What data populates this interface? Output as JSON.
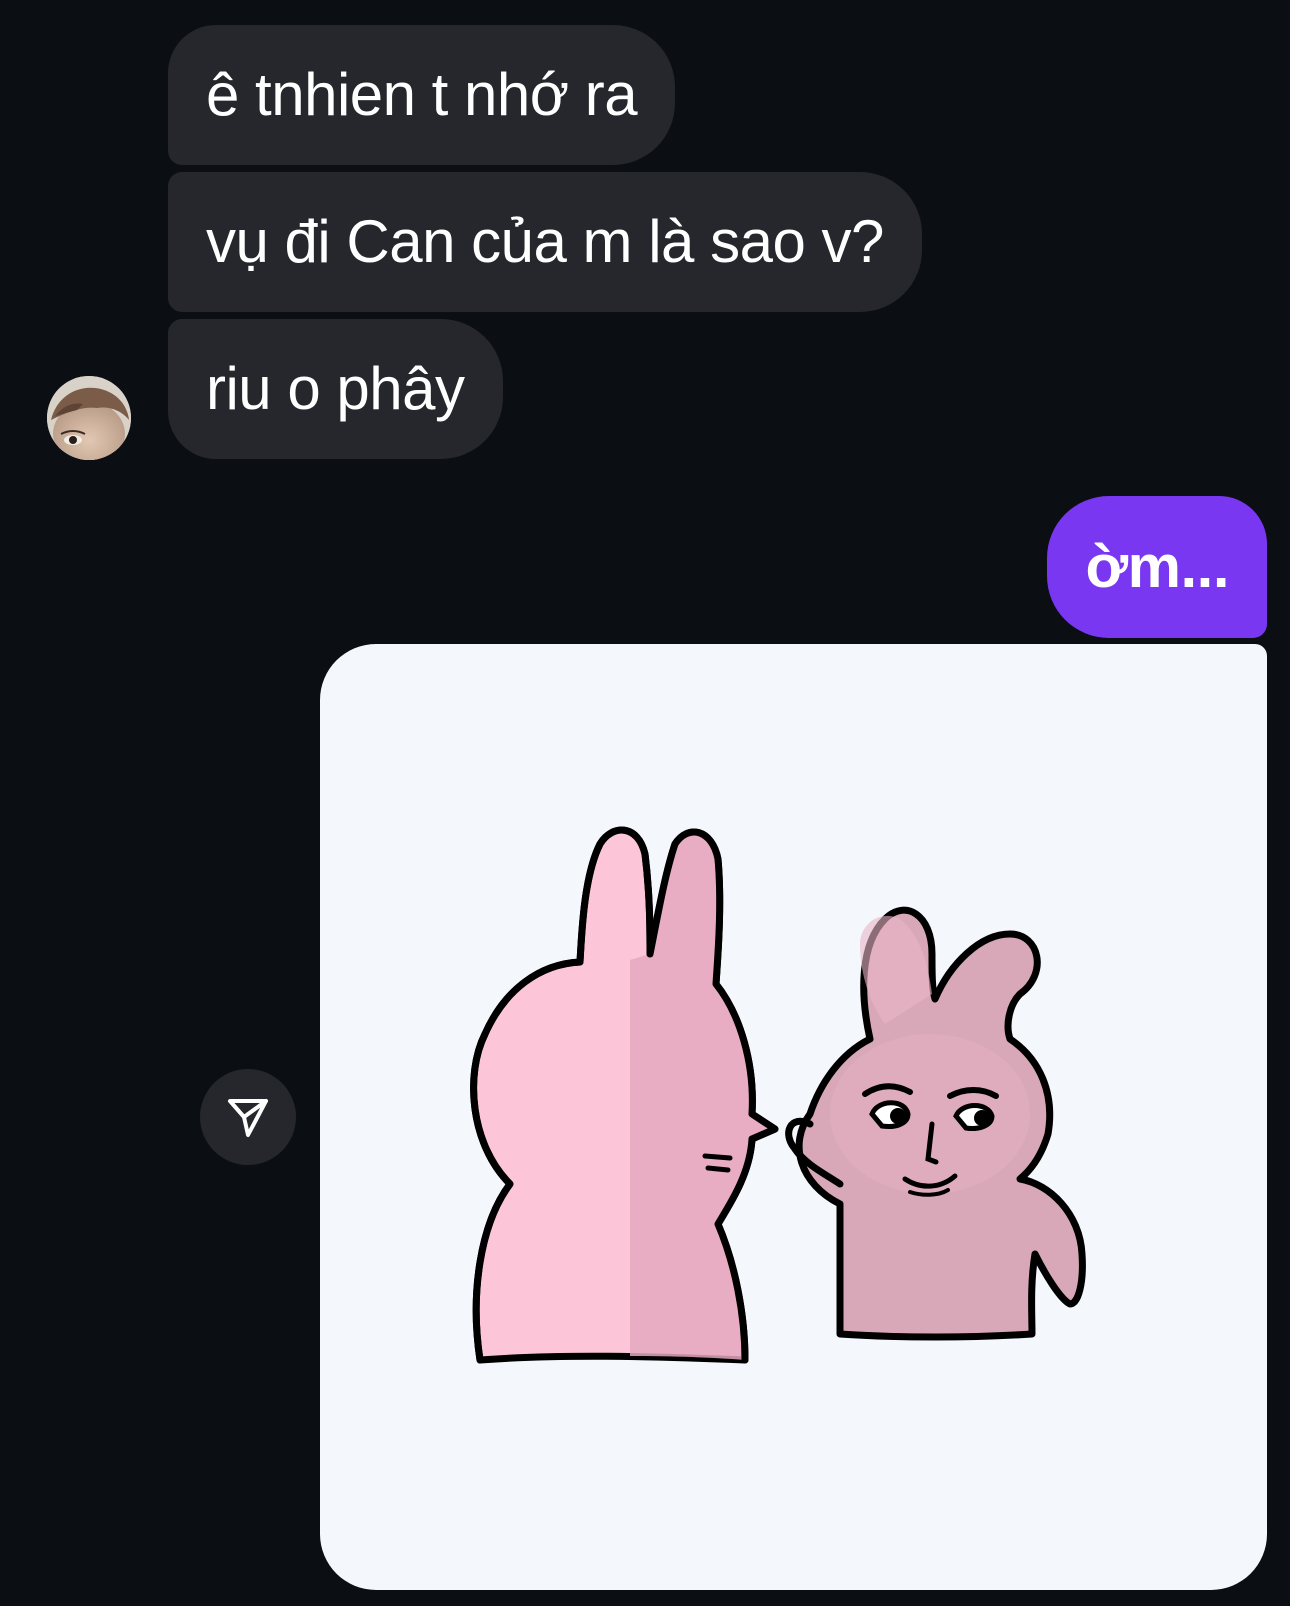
{
  "messages": {
    "incoming": [
      {
        "text": "ê tnhien t nhớ ra"
      },
      {
        "text": "vụ đi Can của m là sao v?"
      },
      {
        "text": "riu o phây"
      }
    ],
    "outgoing": [
      {
        "text": "ờm..."
      }
    ]
  },
  "icons": {
    "share": "paper-plane-icon",
    "avatar": "contact-avatar",
    "sticker": "pink-rabbits-sticker"
  },
  "colors": {
    "background": "#0b0f13",
    "incoming_bubble": "#25272d",
    "outgoing_bubble": "#7a37f2",
    "sticker_background": "#f4f7fc",
    "rabbit_pink": "#fcc6d8",
    "rabbit_shade": "#d8a8b8"
  }
}
